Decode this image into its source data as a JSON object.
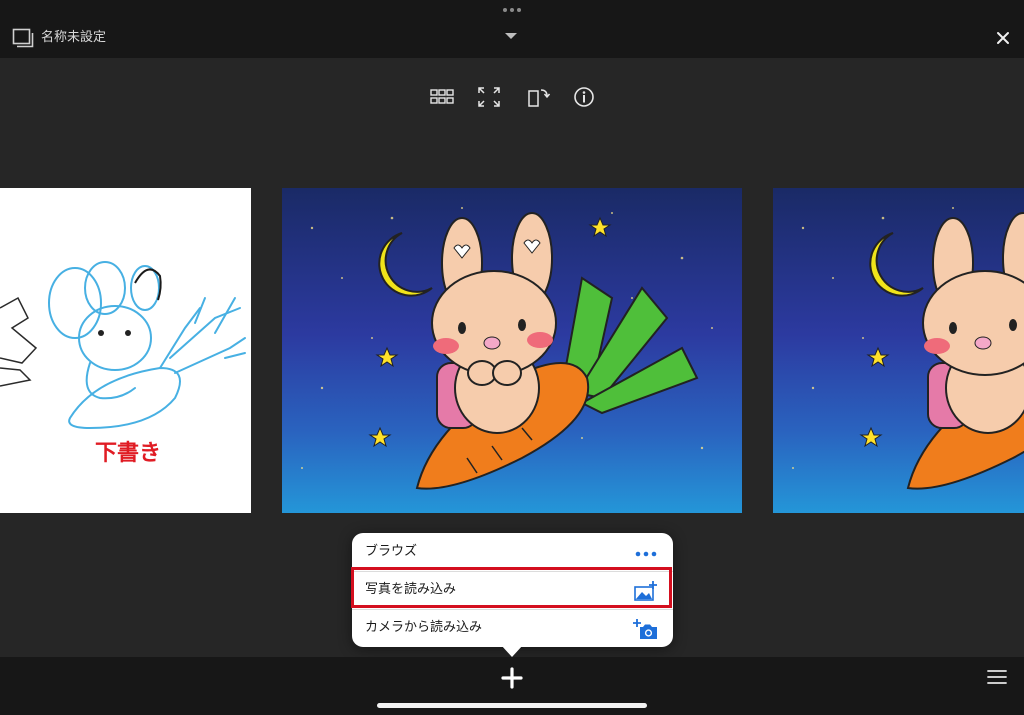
{
  "document": {
    "title": "名称未設定"
  },
  "toolbar": {
    "icons": [
      "grid-icon",
      "fullscreen-icon",
      "rotate-icon",
      "info-icon"
    ]
  },
  "panels": {
    "sketch_label": "下書き"
  },
  "popover": {
    "items": [
      {
        "label": "ブラウズ",
        "icon": "more-icon"
      },
      {
        "label": "写真を読み込み",
        "icon": "photo-add-icon"
      },
      {
        "label": "カメラから読み込み",
        "icon": "camera-add-icon"
      }
    ],
    "highlight_color": "#d40f1f",
    "icon_color": "#1e6fd9"
  },
  "bottombar": {
    "icons": [
      "plus-icon",
      "menu-icon"
    ]
  }
}
